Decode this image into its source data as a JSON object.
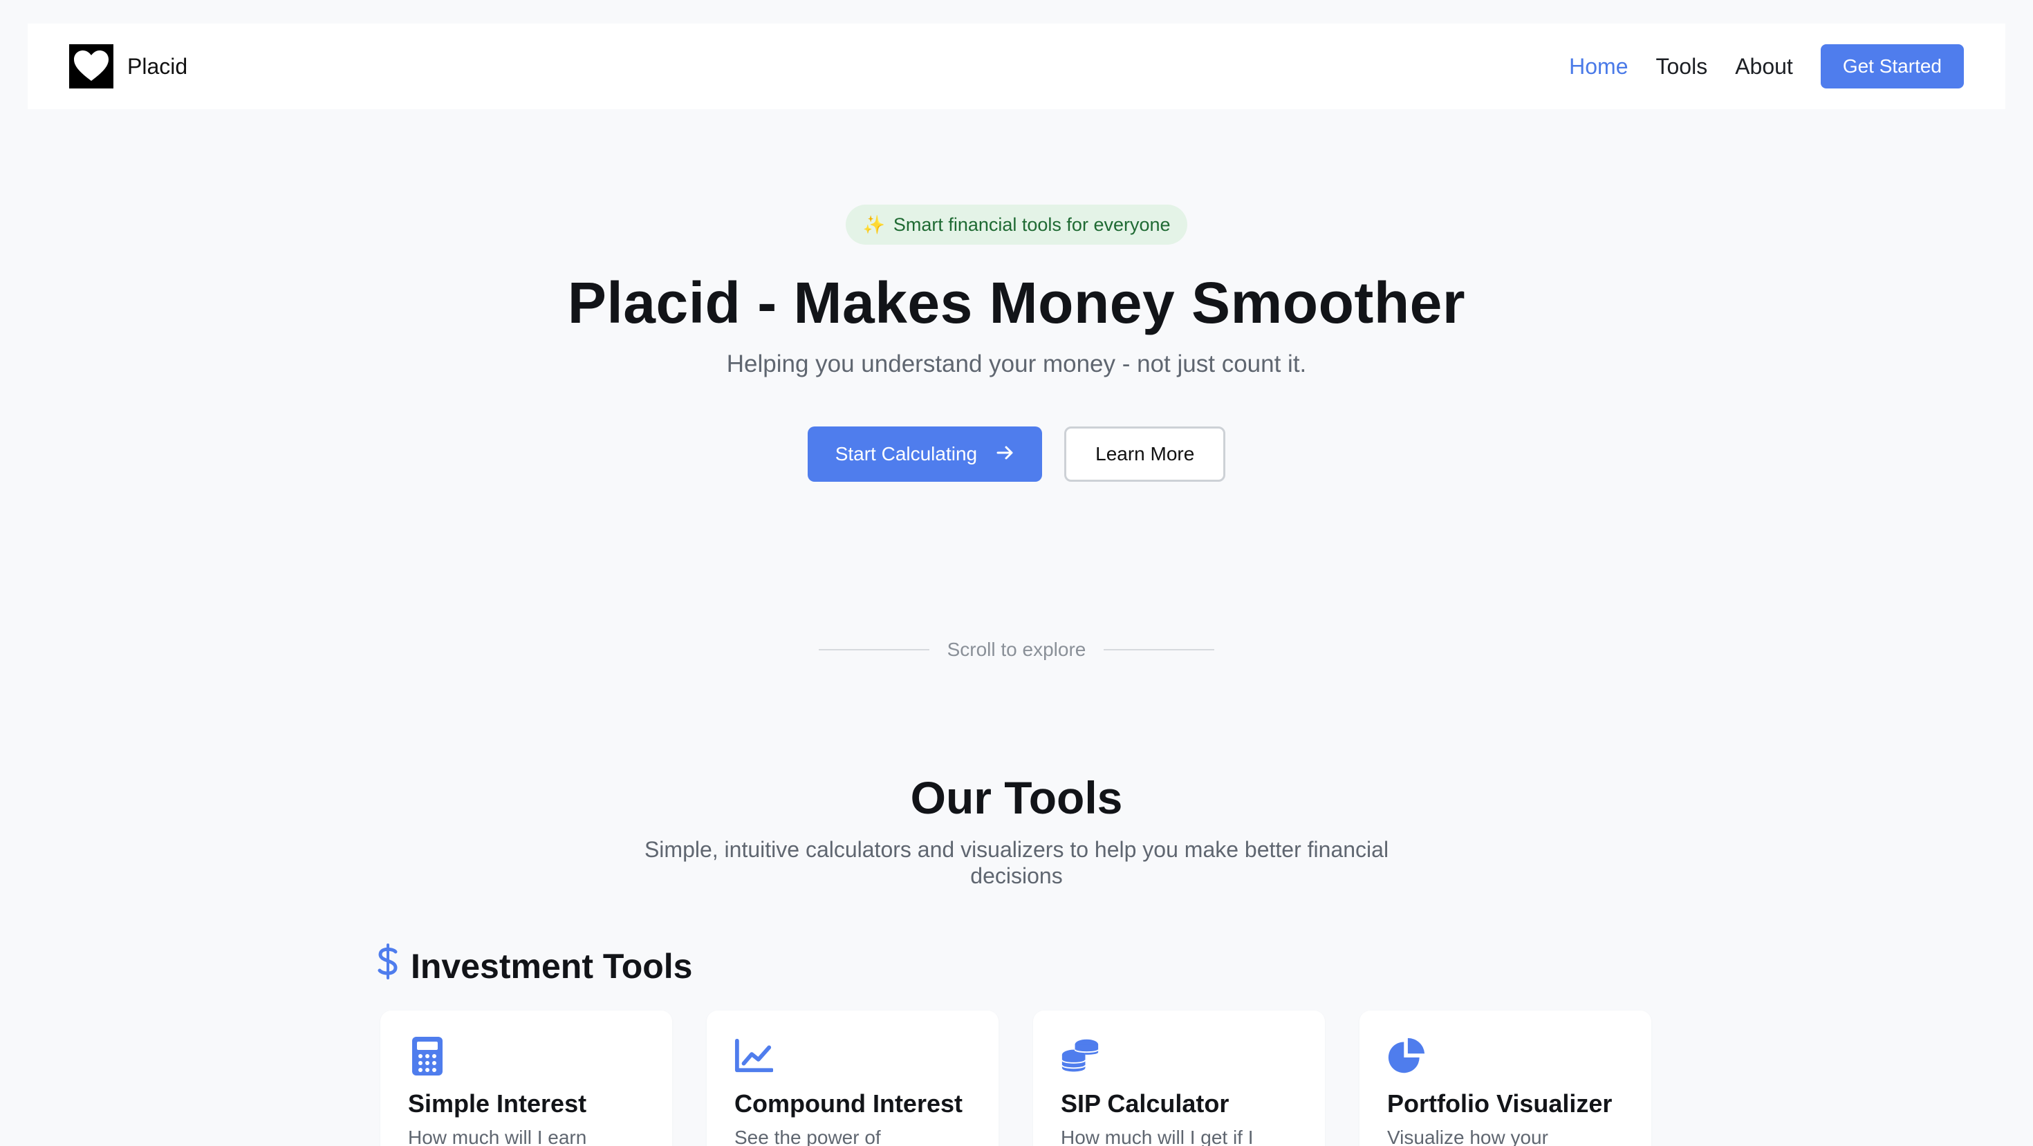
{
  "nav": {
    "brand": "Placid",
    "links": [
      {
        "label": "Home",
        "active": true
      },
      {
        "label": "Tools",
        "active": false
      },
      {
        "label": "About",
        "active": false
      }
    ],
    "cta": "Get Started"
  },
  "hero": {
    "badge_icon": "✨",
    "badge": "Smart financial tools for everyone",
    "title": "Placid - Makes Money Smoother",
    "subtitle": "Helping you understand your money - not just count it.",
    "primary_button": "Start Calculating",
    "secondary_button": "Learn More"
  },
  "scroll_hint": "Scroll to explore",
  "tools": {
    "title": "Our Tools",
    "subtitle": "Simple, intuitive calculators and visualizers to help you make better financial decisions",
    "category": {
      "icon": "dollar-icon",
      "title": "Investment Tools"
    },
    "cards": [
      {
        "icon": "calculator-icon",
        "title": "Simple Interest",
        "desc": "How much will I earn"
      },
      {
        "icon": "chart-line-icon",
        "title": "Compound Interest",
        "desc": "See the power of"
      },
      {
        "icon": "coins-icon",
        "title": "SIP Calculator",
        "desc": "How much will I get if I"
      },
      {
        "icon": "pie-chart-icon",
        "title": "Portfolio Visualizer",
        "desc": "Visualize how your"
      }
    ]
  },
  "colors": {
    "accent": "#4f7ded",
    "badge_bg": "#e4f3e7",
    "badge_text": "#1f6a33",
    "page_bg": "#f8f9fb"
  }
}
